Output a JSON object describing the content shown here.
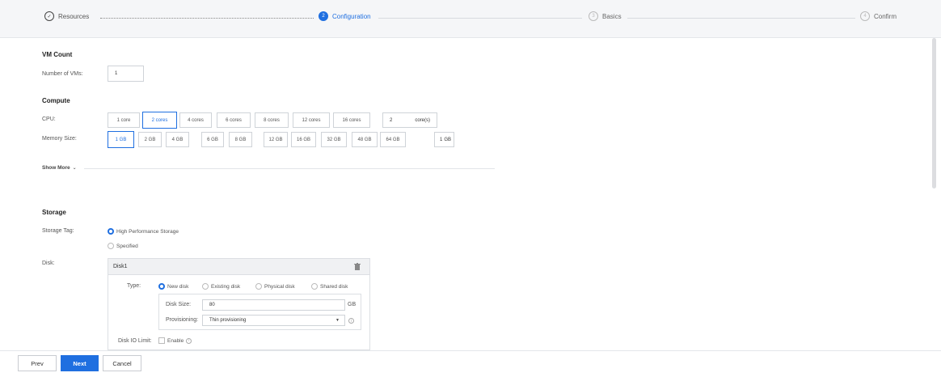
{
  "stepper": {
    "steps": [
      {
        "num": "✓",
        "label": "Resources"
      },
      {
        "num": "2",
        "label": "Configuration"
      },
      {
        "num": "3",
        "label": "Basics"
      },
      {
        "num": "4",
        "label": "Confirm"
      }
    ]
  },
  "vm_count": {
    "title": "VM Count",
    "label": "Number of VMs:",
    "value": "1"
  },
  "compute": {
    "title": "Compute",
    "cpu_label": "CPU:",
    "cpu_options": [
      "1 core",
      "2 cores",
      "4 cores",
      "6 cores",
      "8 cores",
      "12 cores",
      "16 cores"
    ],
    "cpu_custom_value": "2",
    "cpu_custom_unit": "core(s)",
    "memory_label": "Memory Size:",
    "memory_options": [
      "1 GB",
      "2 GB",
      "4 GB",
      "6 GB",
      "8 GB",
      "12 GB",
      "16 GB",
      "32 GB",
      "48 GB",
      "64 GB"
    ],
    "memory_custom_value": "1",
    "memory_custom_unit": "GB",
    "show_more": "Show More"
  },
  "storage": {
    "title": "Storage",
    "tag_label": "Storage Tag:",
    "tag_options": [
      "High Performance Storage",
      "Specified"
    ],
    "disk_label": "Disk:",
    "disk_name": "Disk1",
    "type_label": "Type:",
    "type_options": [
      "New disk",
      "Existing disk",
      "Physical disk",
      "Shared disk"
    ],
    "size_label": "Disk Size:",
    "size_value": "80",
    "size_unit": "GB",
    "provisioning_label": "Provisioning:",
    "provisioning_value": "Thin provisioning",
    "io_limit_label": "Disk IO Limit:",
    "io_limit_option": "Enable"
  },
  "footer": {
    "prev": "Prev",
    "next": "Next",
    "cancel": "Cancel"
  }
}
